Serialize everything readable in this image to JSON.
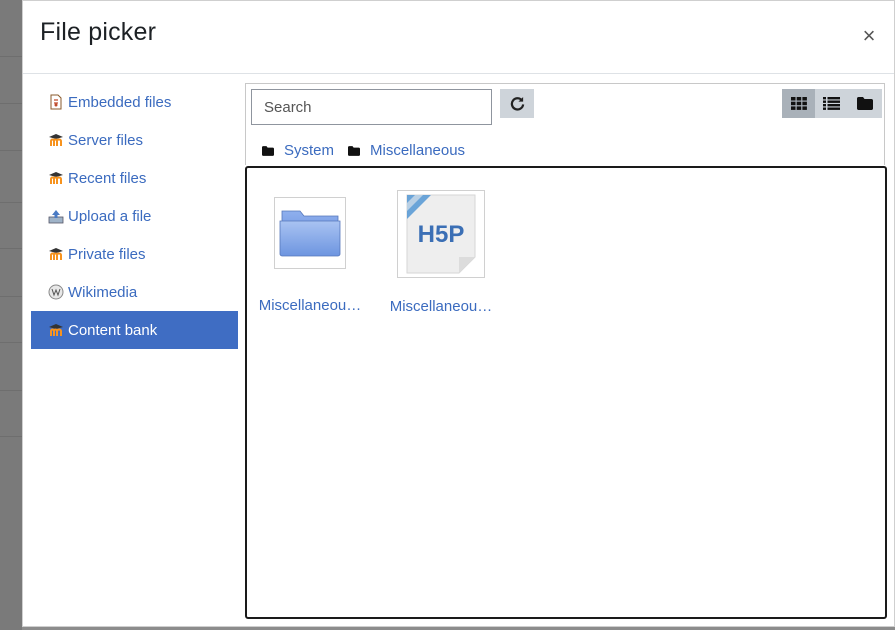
{
  "dialog": {
    "title": "File picker",
    "close_symbol": "×"
  },
  "repositories": [
    {
      "label": "Embedded files",
      "icon": "embedded-files-icon",
      "active": false
    },
    {
      "label": "Server files",
      "icon": "moodle-icon",
      "active": false
    },
    {
      "label": "Recent files",
      "icon": "moodle-icon",
      "active": false
    },
    {
      "label": "Upload a file",
      "icon": "upload-icon",
      "active": false
    },
    {
      "label": "Private files",
      "icon": "moodle-icon",
      "active": false
    },
    {
      "label": "Wikimedia",
      "icon": "wikimedia-icon",
      "active": false
    },
    {
      "label": "Content bank",
      "icon": "moodle-icon",
      "active": true
    }
  ],
  "toolbar": {
    "search_placeholder": "Search",
    "view_modes": [
      "icons",
      "list",
      "tree"
    ],
    "active_view": "icons"
  },
  "breadcrumb": [
    {
      "label": "System"
    },
    {
      "label": "Miscellaneous"
    }
  ],
  "files": [
    {
      "name": "Miscellaneou…",
      "type": "folder"
    },
    {
      "name": "Miscellaneou…",
      "type": "h5p",
      "badge_text": "H5P"
    }
  ],
  "colors": {
    "accent": "#3f6dc3",
    "link": "#3b6bbf",
    "button_bg": "#ced4da"
  }
}
